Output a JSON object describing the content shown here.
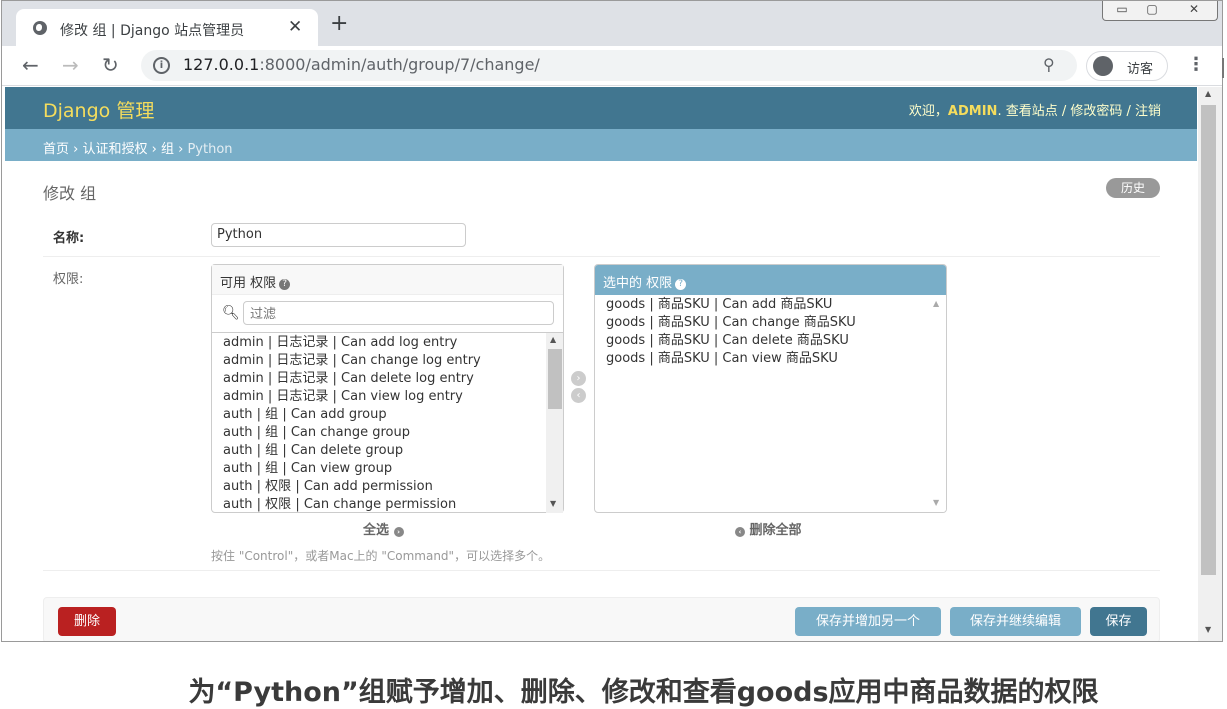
{
  "browser": {
    "tab_title": "修改 组 | Django 站点管理员",
    "new_tab": "+",
    "close_tab": "✕",
    "url_host": "127.0.0.1",
    "url_rest": ":8000/admin/auth/group/7/change/",
    "guest": "访客",
    "win_min": "▭",
    "win_max": "▢",
    "win_close": "✕"
  },
  "header": {
    "brand": "Django 管理",
    "welcome": "欢迎，",
    "user": "ADMIN",
    "links": ". 查看站点 / 修改密码 / 注销"
  },
  "breadcrumb": {
    "home": "首页",
    "app": "认证和授权",
    "model": "组",
    "current": "Python"
  },
  "page": {
    "title": "修改 组",
    "history": "历史"
  },
  "form": {
    "name_label": "名称:",
    "name_value": "Python",
    "perm_label": "权限:"
  },
  "available": {
    "title": "可用 权限",
    "filter_placeholder": "过滤",
    "items": [
      "admin | 日志记录 | Can add log entry",
      "admin | 日志记录 | Can change log entry",
      "admin | 日志记录 | Can delete log entry",
      "admin | 日志记录 | Can view log entry",
      "auth | 组 | Can add group",
      "auth | 组 | Can change group",
      "auth | 组 | Can delete group",
      "auth | 组 | Can view group",
      "auth | 权限 | Can add permission",
      "auth | 权限 | Can change permission"
    ],
    "choose_all": "全选"
  },
  "chosen": {
    "title": "选中的 权限",
    "items": [
      "goods | 商品SKU | Can add 商品SKU",
      "goods | 商品SKU | Can change 商品SKU",
      "goods | 商品SKU | Can delete 商品SKU",
      "goods | 商品SKU | Can view 商品SKU"
    ],
    "remove_all": "删除全部"
  },
  "help": "按住 \"Control\"，或者Mac上的 \"Command\"，可以选择多个。",
  "buttons": {
    "delete": "删除",
    "save_add": "保存并增加另一个",
    "save_continue": "保存并继续编辑",
    "save": "保存"
  },
  "caption": "为“Python”组赋予增加、删除、修改和查看goods应用中商品数据的权限"
}
